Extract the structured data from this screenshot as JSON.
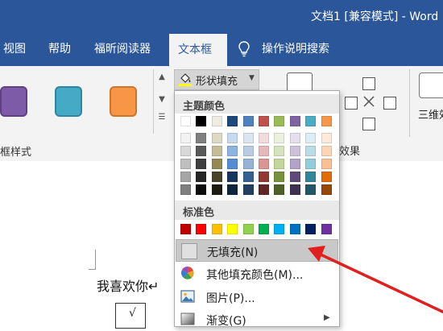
{
  "titlebar": {
    "title": "文档1 [兼容模式] - Word"
  },
  "tabs": [
    "视图",
    "帮助",
    "福昕阅读器",
    "文本框",
    "操作说明搜索"
  ],
  "ribbon": {
    "shape_styles_label": "框样式",
    "shape_fill_label": "形状填充",
    "effects_label": "效果",
    "threed_label": "三维效",
    "style_colors": [
      "#7e5ba6",
      "#45aac6",
      "#f79646"
    ]
  },
  "dropdown": {
    "theme_header": "主题颜色",
    "standard_header": "标准色",
    "theme_colors_top": [
      "#ffffff",
      "#000000",
      "#eeece1",
      "#1f497d",
      "#4f81bd",
      "#c0504d",
      "#9bbb59",
      "#8064a2",
      "#4bacc6",
      "#f79646"
    ],
    "theme_shades": [
      [
        "#f2f2f2",
        "#808080",
        "#ddd9c3",
        "#c6d9f0",
        "#dbe5f1",
        "#f2dcdb",
        "#ebf1dd",
        "#e5e0ec",
        "#dbeef3",
        "#fdeada"
      ],
      [
        "#d8d8d8",
        "#595959",
        "#c4bd97",
        "#8db3e2",
        "#b8cce4",
        "#e5b9b7",
        "#d7e3bc",
        "#ccc1d9",
        "#b7dde8",
        "#fbd5b5"
      ],
      [
        "#bfbfbf",
        "#3f3f3f",
        "#938953",
        "#548dd4",
        "#95b3d7",
        "#d99694",
        "#c3d69b",
        "#b2a2c7",
        "#92cddc",
        "#fac08f"
      ],
      [
        "#a5a5a5",
        "#262626",
        "#494429",
        "#17365d",
        "#366092",
        "#953734",
        "#76923c",
        "#5f497a",
        "#31859b",
        "#e36c09"
      ],
      [
        "#7f7f7f",
        "#0c0c0c",
        "#1d1b10",
        "#0f243e",
        "#244061",
        "#632423",
        "#4f6128",
        "#3f3151",
        "#205867",
        "#974806"
      ]
    ],
    "standard_colors": [
      "#c00000",
      "#ff0000",
      "#ffc000",
      "#ffff00",
      "#92d050",
      "#00b050",
      "#00b0f0",
      "#0070c0",
      "#002060",
      "#7030a0"
    ],
    "items": {
      "no_fill": "无填充(N)",
      "more_colors": "其他填充颜色(M)...",
      "picture": "图片(P)...",
      "gradient": "渐变(G)"
    }
  },
  "document": {
    "text": "我喜欢你↵",
    "textbox_mark": "√"
  },
  "icons": {
    "lightbulb": "lightbulb-icon",
    "paint_bucket": "paint-bucket-icon",
    "color_wheel": "color-wheel-icon",
    "picture": "picture-icon",
    "gradient": "gradient-icon"
  },
  "colors": {
    "accent": "#2b579a",
    "annotation_arrow": "#e02020"
  }
}
